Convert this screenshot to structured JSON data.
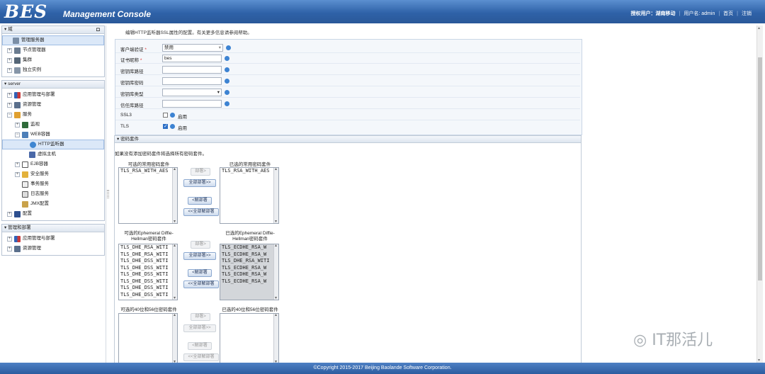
{
  "header": {
    "logo": "BES",
    "title": "Management Console",
    "license_label": "授权用户：",
    "license_value": "湖南移动",
    "user_label": "用户名: ",
    "user_value": "admin",
    "home": "首页",
    "logout": "注销"
  },
  "sidebar": {
    "domain_panel": {
      "title": "域",
      "items": [
        "管理服务器",
        "节点管理器",
        "集群",
        "独立实例"
      ]
    },
    "server_panel": {
      "title": "server",
      "items": [
        "应用管理与部署",
        "资源管理",
        "服务",
        "监视",
        "WEB容器",
        "HTTP监听器",
        "虚拟主机",
        "EJB容器",
        "安全服务",
        "事务服务",
        "日志服务",
        "JMX配置",
        "配置"
      ]
    },
    "mgmt_panel": {
      "title": "管理和部署",
      "items": [
        "应用管理与部署",
        "资源管理"
      ]
    }
  },
  "main": {
    "description": "编辑HTTP监听器SSL属性的配置。有关更多信息请参阅帮助。",
    "form": {
      "client_auth_label": "客户端验证",
      "client_auth_value": "禁用",
      "cert_name_label": "证书昵称",
      "cert_name_value": "bes",
      "keystore_path_label": "密钥库路径",
      "keystore_pwd_label": "密钥库密码",
      "keystore_type_label": "密钥库类型",
      "truststore_path_label": "信任库路径",
      "ssl3_label": "SSL3",
      "ssl3_enable": "启用",
      "tls_label": "TLS",
      "tls_enable": "启用"
    },
    "cipher": {
      "title": "密码套件",
      "note": "如果没有添加密码套件将选择所有密码套件。",
      "common": {
        "avail_label": "可选的常用密码套件",
        "sel_label": "已选的常用密码套件",
        "avail": [
          "TLS_RSA_WITH_AES"
        ],
        "sel": [
          "TLS_RSA_WITH_AES"
        ]
      },
      "ephemeral": {
        "avail_label": "可选的Ephemeral Diffie-Hellman密码套件",
        "sel_label": "已选的Ephemeral Diffie-Hellman密码套件",
        "avail": [
          "TLS_DHE_RSA_WITI",
          "TLS_DHE_RSA_WITI",
          "TLS_DHE_DSS_WITI",
          "TLS_DHE_DSS_WITI",
          "TLS_DHE_DSS_WITI",
          "TLS_DHE_DSS_WITI",
          "TLS_DHE_DSS_WITI",
          "TLS_DHE_DSS_WITI"
        ],
        "sel": [
          "TLS_ECDHE_RSA_W",
          "TLS_ECDHE_RSA_W",
          "TLS_DHE_RSA_WITI",
          "TLS_ECDHE_RSA_W",
          "TLS_ECDHE_RSA_W",
          "TLS_ECDHE_RSA_W"
        ]
      },
      "weak": {
        "avail_label": "可选的40位和56位密码套件",
        "sel_label": "已选的40位和56位密码套件"
      },
      "buttons": {
        "add": "部署>",
        "add_all": "全部部署>>",
        "remove": "<解部署",
        "remove_all": "<<全部解部署"
      }
    }
  },
  "footer": "©Copyright 2015-2017 Beijing Baolande Software Corporation.",
  "watermark": "IT那活儿"
}
